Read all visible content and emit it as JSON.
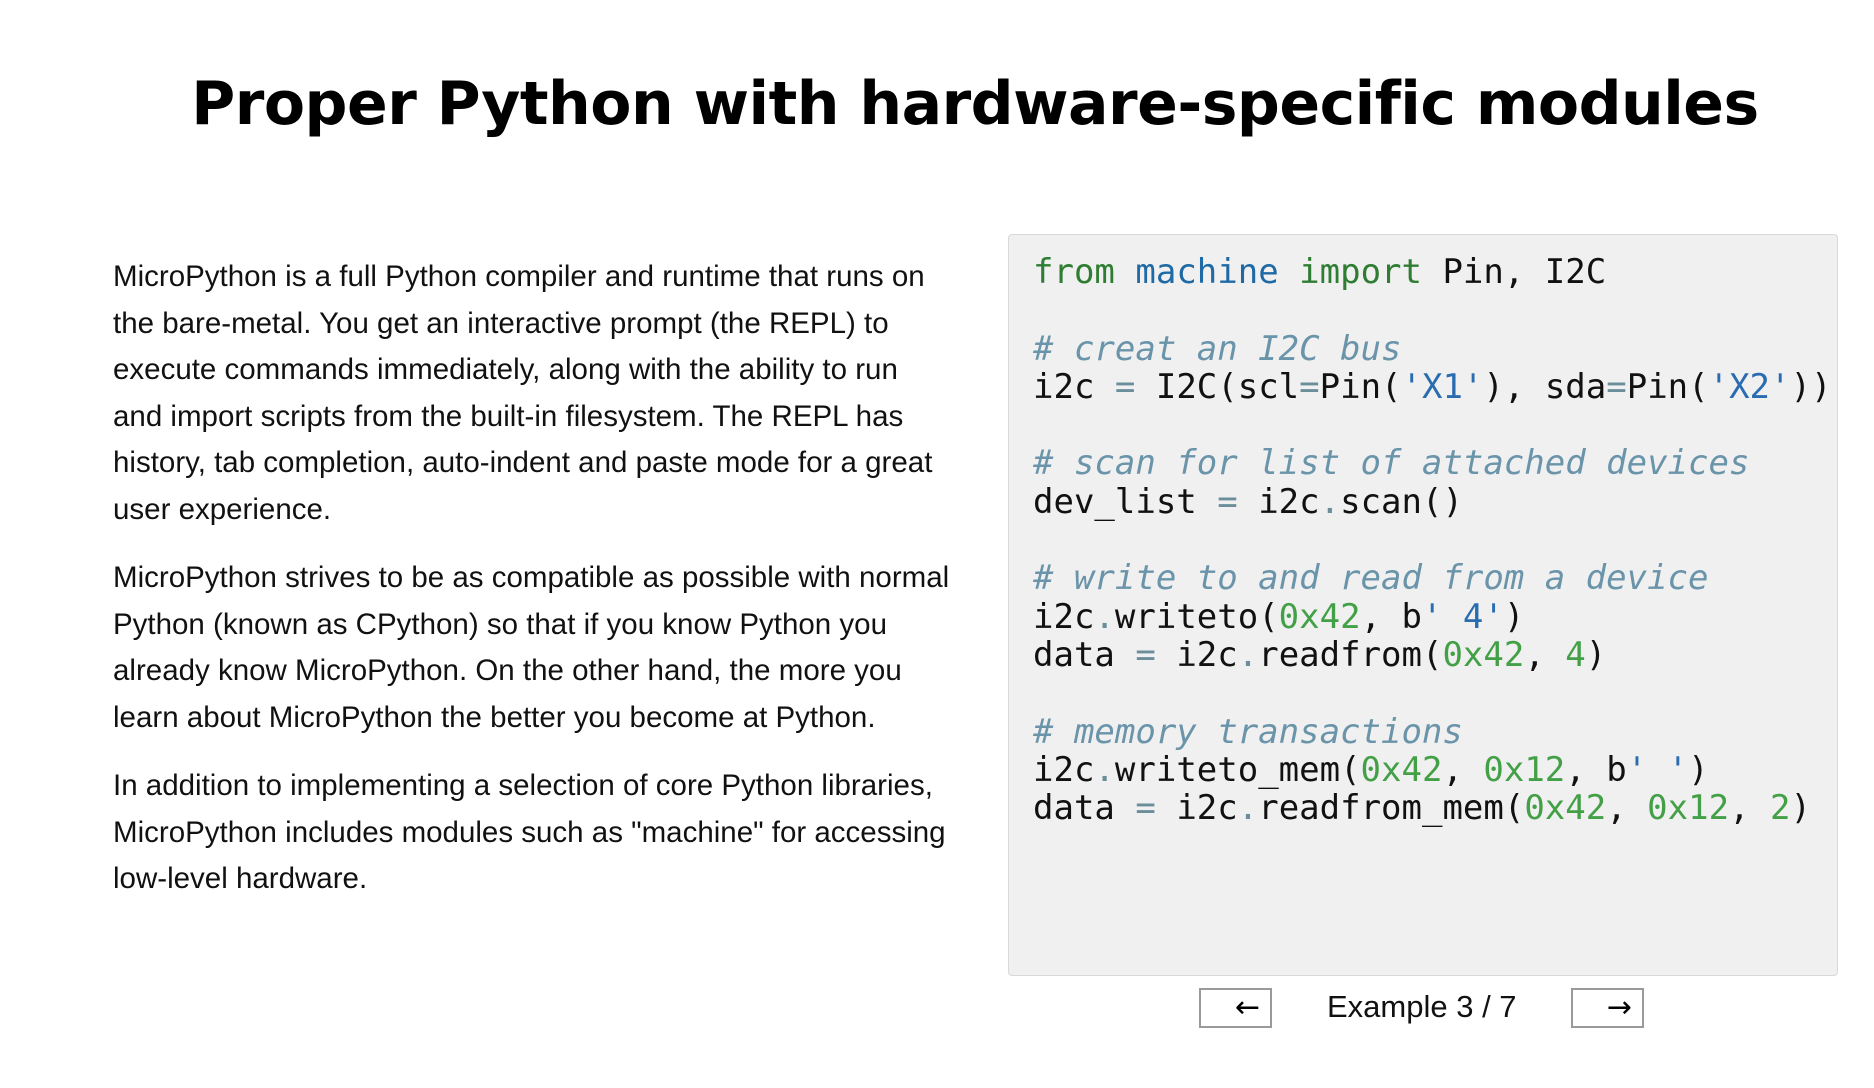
{
  "page": {
    "title": "Proper Python with hardware-specific modules"
  },
  "description": {
    "paragraphs": [
      "MicroPython is a full Python compiler and runtime that runs on the bare-metal. You get an interactive prompt (the REPL) to execute commands immediately, along with the ability to run and import scripts from the built-in filesystem. The REPL has history, tab completion, auto-indent and paste mode for a great user experience.",
      "MicroPython strives to be as compatible as possible with normal Python (known as CPython) so that if you know Python you already know MicroPython. On the other hand, the more you learn about MicroPython the better you become at Python.",
      "In addition to implementing a selection of core Python libraries, MicroPython includes modules such as \"machine\" for accessing low-level hardware."
    ]
  },
  "code_example": {
    "lines": [
      [
        {
          "t": "from",
          "k": "kw"
        },
        {
          "t": " "
        },
        {
          "t": "machine",
          "k": "mod"
        },
        {
          "t": " "
        },
        {
          "t": "import",
          "k": "kw"
        },
        {
          "t": " Pin, I2C"
        }
      ],
      [],
      [
        {
          "t": "# creat an I2C bus",
          "k": "cm"
        }
      ],
      [
        {
          "t": "i2c "
        },
        {
          "t": "=",
          "k": "op"
        },
        {
          "t": " I2C(scl"
        },
        {
          "t": "=",
          "k": "op"
        },
        {
          "t": "Pin("
        },
        {
          "t": "'X1'",
          "k": "str"
        },
        {
          "t": "), sda"
        },
        {
          "t": "=",
          "k": "op"
        },
        {
          "t": "Pin("
        },
        {
          "t": "'X2'",
          "k": "str"
        },
        {
          "t": "))"
        }
      ],
      [],
      [
        {
          "t": "# scan for list of attached devices",
          "k": "cm"
        }
      ],
      [
        {
          "t": "dev_list "
        },
        {
          "t": "=",
          "k": "op"
        },
        {
          "t": " i2c"
        },
        {
          "t": ".",
          "k": "op"
        },
        {
          "t": "scan()"
        }
      ],
      [],
      [
        {
          "t": "# write to and read from a device",
          "k": "cm"
        }
      ],
      [
        {
          "t": "i2c"
        },
        {
          "t": ".",
          "k": "op"
        },
        {
          "t": "writeto("
        },
        {
          "t": "0x42",
          "k": "num"
        },
        {
          "t": ", b"
        },
        {
          "t": "' 4'",
          "k": "str"
        },
        {
          "t": ")"
        }
      ],
      [
        {
          "t": "data "
        },
        {
          "t": "=",
          "k": "op"
        },
        {
          "t": " i2c"
        },
        {
          "t": ".",
          "k": "op"
        },
        {
          "t": "readfrom("
        },
        {
          "t": "0x42",
          "k": "num"
        },
        {
          "t": ", "
        },
        {
          "t": "4",
          "k": "num"
        },
        {
          "t": ")"
        }
      ],
      [],
      [
        {
          "t": "# memory transactions",
          "k": "cm"
        }
      ],
      [
        {
          "t": "i2c"
        },
        {
          "t": ".",
          "k": "op"
        },
        {
          "t": "writeto_mem("
        },
        {
          "t": "0x42",
          "k": "num"
        },
        {
          "t": ", "
        },
        {
          "t": "0x12",
          "k": "num"
        },
        {
          "t": ", b"
        },
        {
          "t": "' '",
          "k": "str"
        },
        {
          "t": ")"
        }
      ],
      [
        {
          "t": "data "
        },
        {
          "t": "=",
          "k": "op"
        },
        {
          "t": " i2c"
        },
        {
          "t": ".",
          "k": "op"
        },
        {
          "t": "readfrom_mem("
        },
        {
          "t": "0x42",
          "k": "num"
        },
        {
          "t": ", "
        },
        {
          "t": "0x12",
          "k": "num"
        },
        {
          "t": ", "
        },
        {
          "t": "2",
          "k": "num"
        },
        {
          "t": ")"
        }
      ]
    ]
  },
  "pager": {
    "prev_label": "←",
    "next_label": "→",
    "status_label": "Example 3 / 7"
  },
  "colors": {
    "code_background": "#f0f0f0",
    "keyword": "#2e7d32",
    "module": "#1f6aa5",
    "comment": "#6a94aa",
    "string": "#2a6cb0",
    "number": "#43a047"
  }
}
